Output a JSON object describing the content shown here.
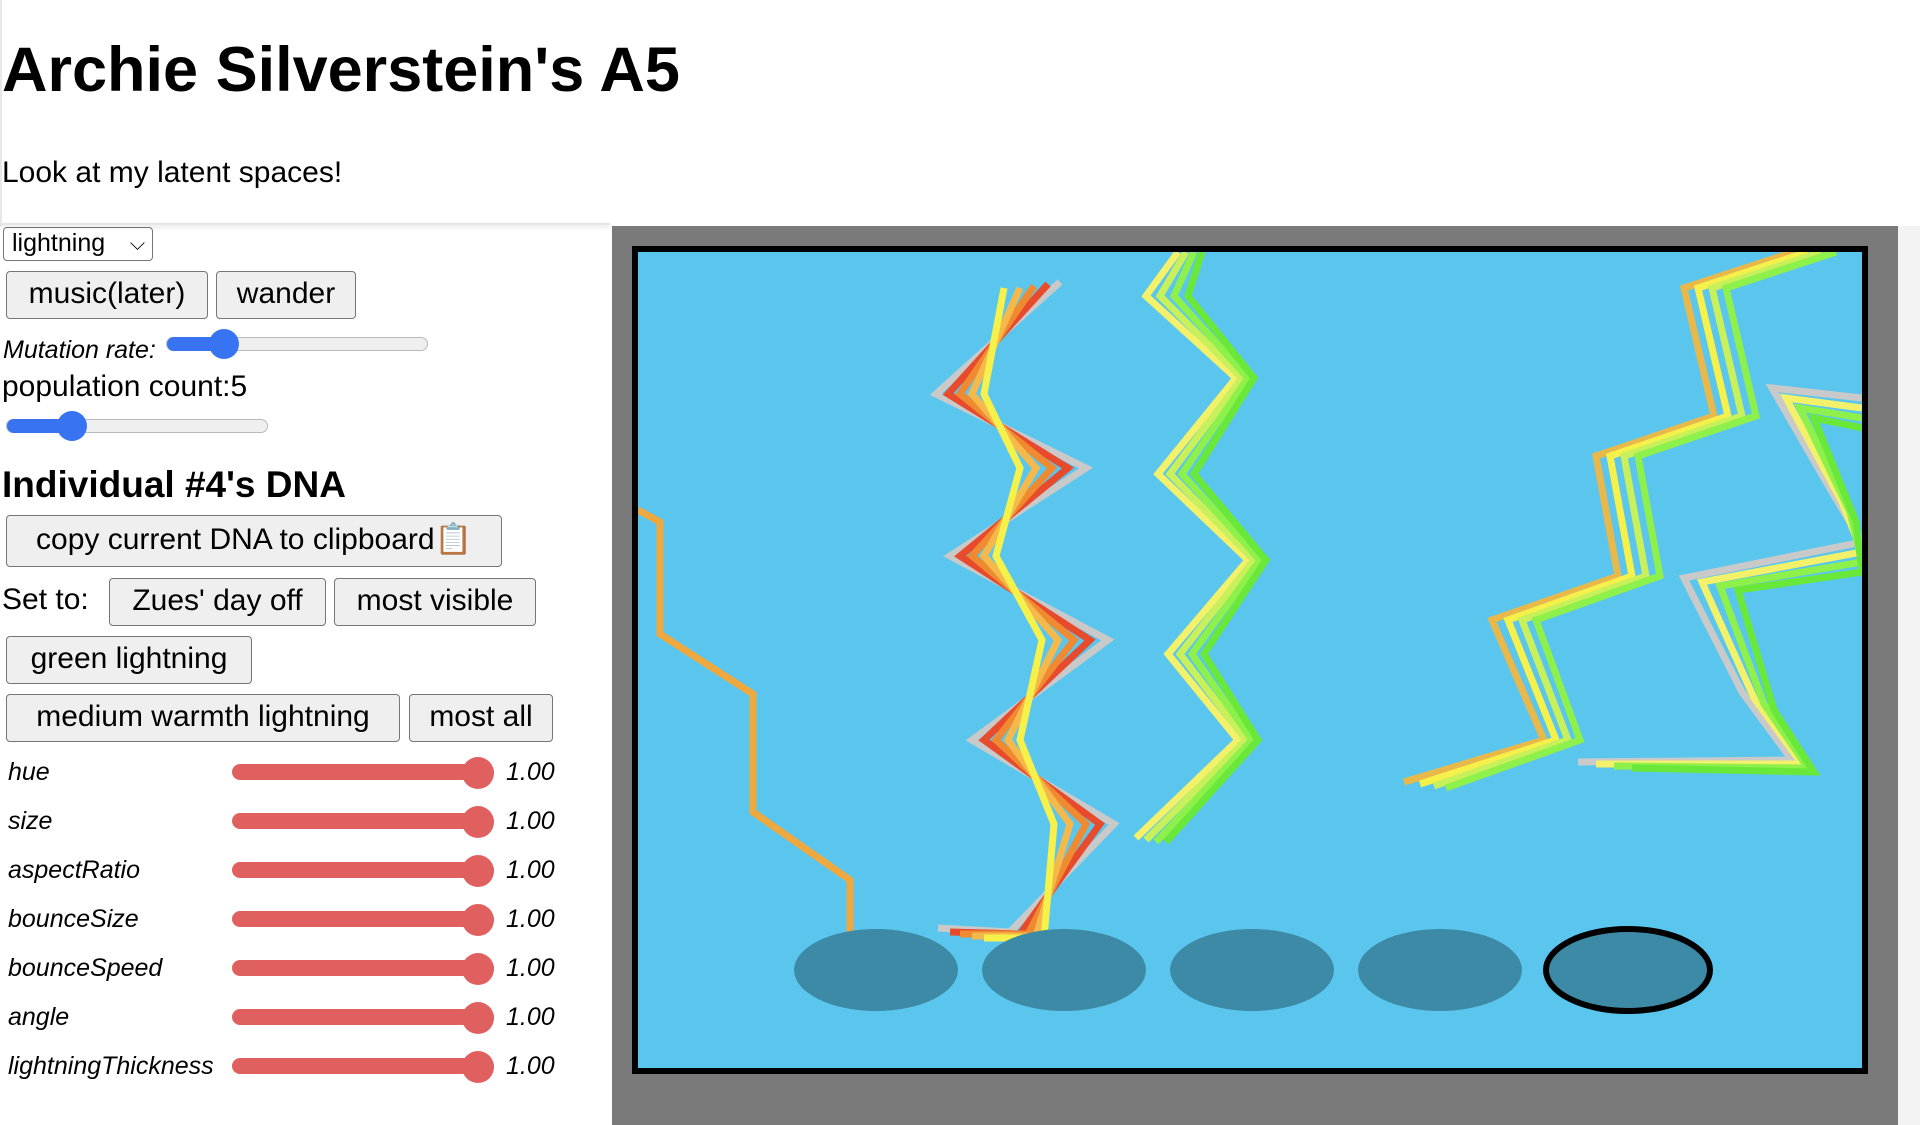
{
  "header": {
    "title": "Archie Silverstein's A5",
    "subtitle": "Look at my latent spaces!"
  },
  "controls": {
    "select_value": "lightning",
    "music_button": "music(later)",
    "wander_button": "wander",
    "mutation_label": "Mutation rate:",
    "mutation_rate": 0.22,
    "population_label": "population count:5",
    "population_level": 0.25,
    "dna_heading": "Individual #4's DNA",
    "copy_button": "copy current DNA to clipboard📋",
    "set_to_label": "Set to:",
    "presets": [
      "Zues' day off",
      "most visible",
      "green lightning",
      "medium warmth lightning",
      "most all"
    ]
  },
  "dna": [
    {
      "name": "hue",
      "value": "1.00"
    },
    {
      "name": "size",
      "value": "1.00"
    },
    {
      "name": "aspectRatio",
      "value": "1.00"
    },
    {
      "name": "bounceSize",
      "value": "1.00"
    },
    {
      "name": "bounceSpeed",
      "value": "1.00"
    },
    {
      "name": "angle",
      "value": "1.00"
    },
    {
      "name": "lightningThickness",
      "value": "1.00"
    }
  ],
  "colors": {
    "sky": "#5bc6ed",
    "shadow": "#3d8aa6",
    "slider_red": "#e06060",
    "slider_blue": "#3874f2",
    "frame_gray": "#7a7a7a"
  }
}
